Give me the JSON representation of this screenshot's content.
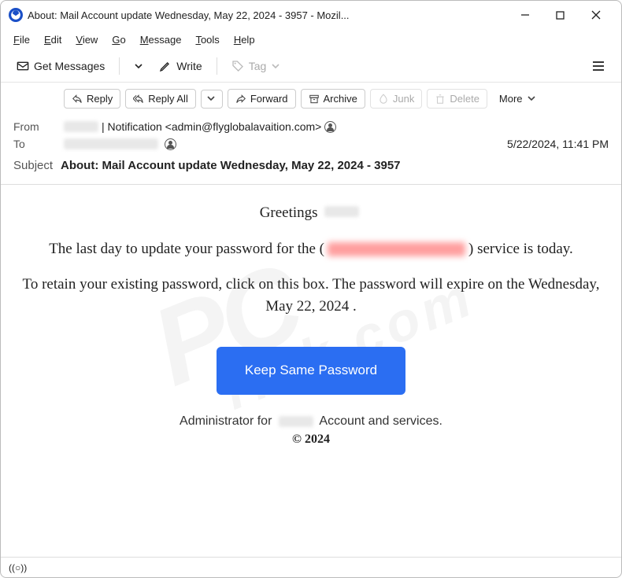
{
  "window": {
    "title": "About: Mail Account update Wednesday, May 22, 2024 - 3957 - Mozil..."
  },
  "menu": {
    "file": "File",
    "edit": "Edit",
    "view": "View",
    "go": "Go",
    "message": "Message",
    "tools": "Tools",
    "help": "Help"
  },
  "toolbar": {
    "get_messages": "Get Messages",
    "write": "Write",
    "tag": "Tag"
  },
  "actions": {
    "reply": "Reply",
    "reply_all": "Reply All",
    "forward": "Forward",
    "archive": "Archive",
    "junk": "Junk",
    "delete": "Delete",
    "more": "More"
  },
  "headers": {
    "from_label": "From",
    "from_text": "| Notification <admin@flyglobalavaition.com>",
    "to_label": "To",
    "date": "5/22/2024, 11:41 PM",
    "subject_label": "Subject",
    "subject": "About: Mail Account update Wednesday, May 22, 2024 - 3957"
  },
  "body": {
    "greeting": "Greetings",
    "line1_a": "The last day to update your password for the (",
    "line1_b": ") service is today.",
    "line2": "To retain your existing password, click on this box. The password will expire on the Wednesday, May 22, 2024 .",
    "cta": "Keep Same Password",
    "admin_a": "Administrator for",
    "admin_b": "Account and services.",
    "copyright": "© 2024"
  },
  "status": {
    "connection": "((○))"
  }
}
